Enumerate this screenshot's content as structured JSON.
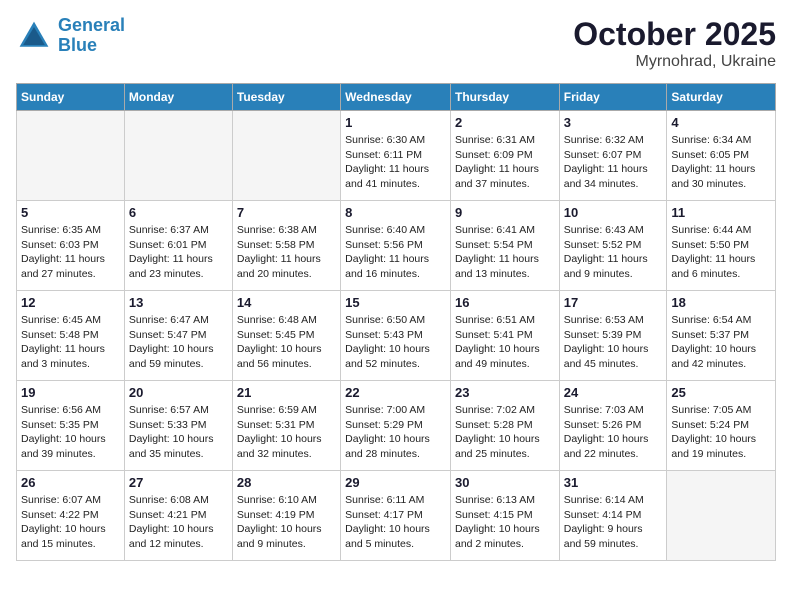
{
  "header": {
    "logo_line1": "General",
    "logo_line2": "Blue",
    "month": "October 2025",
    "location": "Myrnohrad, Ukraine"
  },
  "weekdays": [
    "Sunday",
    "Monday",
    "Tuesday",
    "Wednesday",
    "Thursday",
    "Friday",
    "Saturday"
  ],
  "weeks": [
    [
      {
        "day": "",
        "info": "",
        "empty": true
      },
      {
        "day": "",
        "info": "",
        "empty": true
      },
      {
        "day": "",
        "info": "",
        "empty": true
      },
      {
        "day": "1",
        "info": "Sunrise: 6:30 AM\nSunset: 6:11 PM\nDaylight: 11 hours\nand 41 minutes.",
        "empty": false
      },
      {
        "day": "2",
        "info": "Sunrise: 6:31 AM\nSunset: 6:09 PM\nDaylight: 11 hours\nand 37 minutes.",
        "empty": false
      },
      {
        "day": "3",
        "info": "Sunrise: 6:32 AM\nSunset: 6:07 PM\nDaylight: 11 hours\nand 34 minutes.",
        "empty": false
      },
      {
        "day": "4",
        "info": "Sunrise: 6:34 AM\nSunset: 6:05 PM\nDaylight: 11 hours\nand 30 minutes.",
        "empty": false
      }
    ],
    [
      {
        "day": "5",
        "info": "Sunrise: 6:35 AM\nSunset: 6:03 PM\nDaylight: 11 hours\nand 27 minutes.",
        "empty": false
      },
      {
        "day": "6",
        "info": "Sunrise: 6:37 AM\nSunset: 6:01 PM\nDaylight: 11 hours\nand 23 minutes.",
        "empty": false
      },
      {
        "day": "7",
        "info": "Sunrise: 6:38 AM\nSunset: 5:58 PM\nDaylight: 11 hours\nand 20 minutes.",
        "empty": false
      },
      {
        "day": "8",
        "info": "Sunrise: 6:40 AM\nSunset: 5:56 PM\nDaylight: 11 hours\nand 16 minutes.",
        "empty": false
      },
      {
        "day": "9",
        "info": "Sunrise: 6:41 AM\nSunset: 5:54 PM\nDaylight: 11 hours\nand 13 minutes.",
        "empty": false
      },
      {
        "day": "10",
        "info": "Sunrise: 6:43 AM\nSunset: 5:52 PM\nDaylight: 11 hours\nand 9 minutes.",
        "empty": false
      },
      {
        "day": "11",
        "info": "Sunrise: 6:44 AM\nSunset: 5:50 PM\nDaylight: 11 hours\nand 6 minutes.",
        "empty": false
      }
    ],
    [
      {
        "day": "12",
        "info": "Sunrise: 6:45 AM\nSunset: 5:48 PM\nDaylight: 11 hours\nand 3 minutes.",
        "empty": false
      },
      {
        "day": "13",
        "info": "Sunrise: 6:47 AM\nSunset: 5:47 PM\nDaylight: 10 hours\nand 59 minutes.",
        "empty": false
      },
      {
        "day": "14",
        "info": "Sunrise: 6:48 AM\nSunset: 5:45 PM\nDaylight: 10 hours\nand 56 minutes.",
        "empty": false
      },
      {
        "day": "15",
        "info": "Sunrise: 6:50 AM\nSunset: 5:43 PM\nDaylight: 10 hours\nand 52 minutes.",
        "empty": false
      },
      {
        "day": "16",
        "info": "Sunrise: 6:51 AM\nSunset: 5:41 PM\nDaylight: 10 hours\nand 49 minutes.",
        "empty": false
      },
      {
        "day": "17",
        "info": "Sunrise: 6:53 AM\nSunset: 5:39 PM\nDaylight: 10 hours\nand 45 minutes.",
        "empty": false
      },
      {
        "day": "18",
        "info": "Sunrise: 6:54 AM\nSunset: 5:37 PM\nDaylight: 10 hours\nand 42 minutes.",
        "empty": false
      }
    ],
    [
      {
        "day": "19",
        "info": "Sunrise: 6:56 AM\nSunset: 5:35 PM\nDaylight: 10 hours\nand 39 minutes.",
        "empty": false
      },
      {
        "day": "20",
        "info": "Sunrise: 6:57 AM\nSunset: 5:33 PM\nDaylight: 10 hours\nand 35 minutes.",
        "empty": false
      },
      {
        "day": "21",
        "info": "Sunrise: 6:59 AM\nSunset: 5:31 PM\nDaylight: 10 hours\nand 32 minutes.",
        "empty": false
      },
      {
        "day": "22",
        "info": "Sunrise: 7:00 AM\nSunset: 5:29 PM\nDaylight: 10 hours\nand 28 minutes.",
        "empty": false
      },
      {
        "day": "23",
        "info": "Sunrise: 7:02 AM\nSunset: 5:28 PM\nDaylight: 10 hours\nand 25 minutes.",
        "empty": false
      },
      {
        "day": "24",
        "info": "Sunrise: 7:03 AM\nSunset: 5:26 PM\nDaylight: 10 hours\nand 22 minutes.",
        "empty": false
      },
      {
        "day": "25",
        "info": "Sunrise: 7:05 AM\nSunset: 5:24 PM\nDaylight: 10 hours\nand 19 minutes.",
        "empty": false
      }
    ],
    [
      {
        "day": "26",
        "info": "Sunrise: 6:07 AM\nSunset: 4:22 PM\nDaylight: 10 hours\nand 15 minutes.",
        "empty": false
      },
      {
        "day": "27",
        "info": "Sunrise: 6:08 AM\nSunset: 4:21 PM\nDaylight: 10 hours\nand 12 minutes.",
        "empty": false
      },
      {
        "day": "28",
        "info": "Sunrise: 6:10 AM\nSunset: 4:19 PM\nDaylight: 10 hours\nand 9 minutes.",
        "empty": false
      },
      {
        "day": "29",
        "info": "Sunrise: 6:11 AM\nSunset: 4:17 PM\nDaylight: 10 hours\nand 5 minutes.",
        "empty": false
      },
      {
        "day": "30",
        "info": "Sunrise: 6:13 AM\nSunset: 4:15 PM\nDaylight: 10 hours\nand 2 minutes.",
        "empty": false
      },
      {
        "day": "31",
        "info": "Sunrise: 6:14 AM\nSunset: 4:14 PM\nDaylight: 9 hours\nand 59 minutes.",
        "empty": false
      },
      {
        "day": "",
        "info": "",
        "empty": true
      }
    ]
  ]
}
